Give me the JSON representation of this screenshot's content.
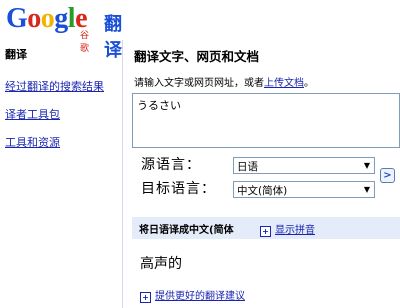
{
  "logo": {
    "word": [
      "G",
      "o",
      "o",
      "g",
      "l",
      "e"
    ],
    "cn": "谷歌",
    "app": "翻译"
  },
  "sidebar": {
    "heading": "翻译",
    "links": [
      "经过翻译的搜索结果",
      "译者工具包",
      "工具和资源"
    ]
  },
  "main": {
    "title": "翻译文字、网页和文档",
    "instruction_prefix": "请输入文字或网页网址，或者",
    "upload_link": "上传文档",
    "instruction_suffix": "。",
    "source_text": "うるさい",
    "source_label": "源语言：",
    "source_value": "日语",
    "target_label": "目标语言：",
    "target_value": "中文(简体)",
    "swap_glyph": ">"
  },
  "result": {
    "title": "将日语译成中文(简体",
    "show_pinyin": "显示拼音",
    "text": "高声的",
    "suggest": "提供更好的翻译建议",
    "plus_glyph": "+"
  },
  "colors": {
    "link": "#1a26b0",
    "result_bar": "#e5ecf9",
    "border": "#7f9db9"
  }
}
